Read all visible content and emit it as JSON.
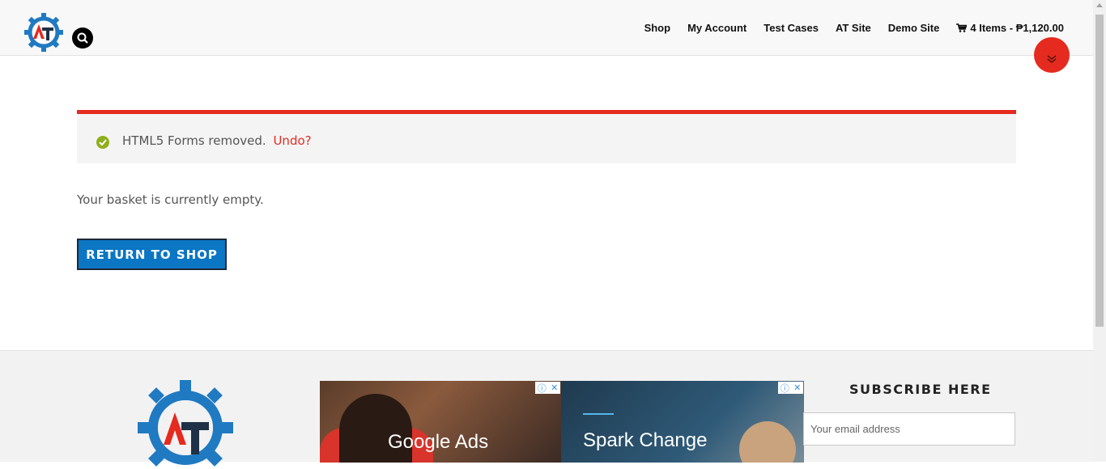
{
  "header": {
    "logo_icon": "at-gear-logo-icon",
    "search_icon": "search-icon",
    "nav": [
      {
        "label": "Shop"
      },
      {
        "label": "My Account"
      },
      {
        "label": "Test Cases"
      },
      {
        "label": "AT Site"
      },
      {
        "label": "Demo Site"
      }
    ],
    "cart": {
      "icon": "cart-icon",
      "label": "4 Items - ₱1,120.00"
    },
    "scroll_toggle_icon": "double-chevron-down-icon"
  },
  "notice": {
    "icon": "check-circle-icon",
    "message": "HTML5 Forms removed.",
    "undo_label": "Undo?"
  },
  "basket": {
    "empty_message": "Your basket is currently empty.",
    "return_button": "RETURN TO SHOP"
  },
  "footer": {
    "ads": [
      {
        "title": "Google Ads"
      },
      {
        "title": "Spark Change"
      }
    ],
    "subscribe": {
      "title": "SUBSCRIBE HERE",
      "placeholder": "Your email address"
    }
  },
  "colors": {
    "accent": "#e52a1f",
    "button": "#0a76c4",
    "success": "#8fae1b"
  }
}
